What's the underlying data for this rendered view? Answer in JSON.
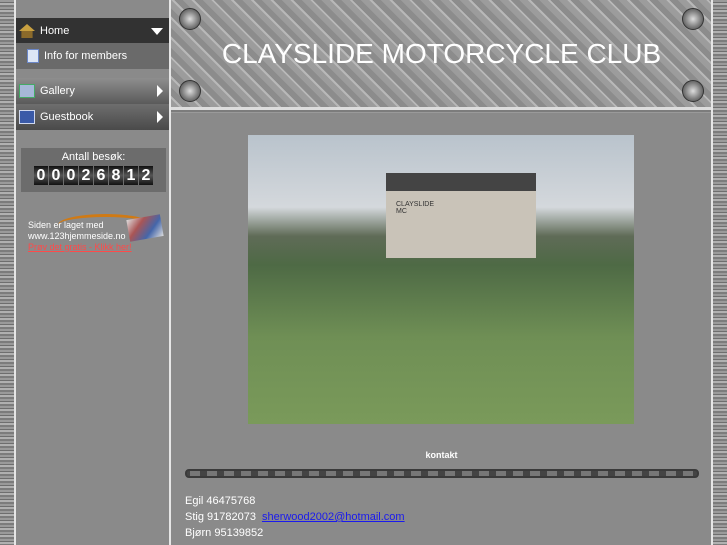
{
  "sidebar": {
    "items": [
      {
        "label": "Home",
        "icon": "home-icon"
      },
      {
        "label": "Info for members",
        "icon": "page-icon"
      },
      {
        "label": "Gallery",
        "icon": "gallery-icon"
      },
      {
        "label": "Guestbook",
        "icon": "book-icon"
      }
    ],
    "counter": {
      "label": "Antall besøk:",
      "digits": [
        "0",
        "0",
        "0",
        "2",
        "6",
        "8",
        "1",
        "2"
      ]
    },
    "ad": {
      "line1": "Siden er laget med",
      "line2": "www.123hjemmeside.no",
      "link": "Prøv det gratis - Klikk her!"
    }
  },
  "header": {
    "title": "CLAYSLIDE MOTORCYCLE CLUB"
  },
  "main": {
    "photo_sign": "CLAYSLIDE MC",
    "section_title": "kontakt",
    "contacts": [
      {
        "text": "Egil 46475768"
      },
      {
        "text": "Stig 91782073",
        "email": "sherwood2002@hotmail.com"
      },
      {
        "text": "Bjørn 95139852"
      }
    ]
  }
}
